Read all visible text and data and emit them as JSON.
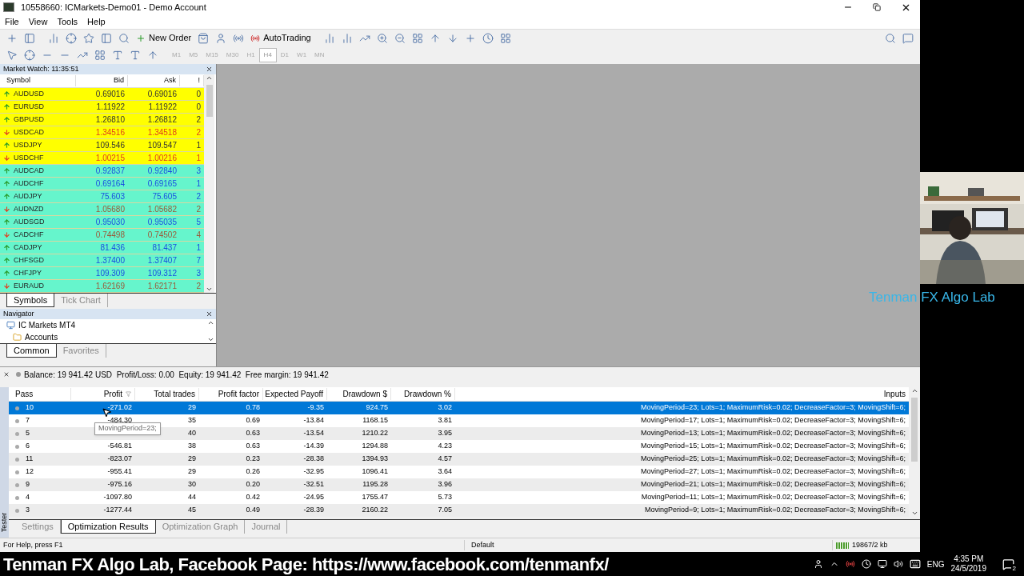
{
  "window": {
    "title": "10558660: ICMarkets-Demo01 - Demo Account"
  },
  "menu": [
    "File",
    "View",
    "Tools",
    "Help"
  ],
  "toolbar": {
    "buttons": [
      {
        "label": "New Order"
      },
      {
        "label": "AutoTrading"
      }
    ]
  },
  "timeframes": [
    {
      "label": "M1",
      "selected": false
    },
    {
      "label": "M5",
      "selected": false
    },
    {
      "label": "M15",
      "selected": false
    },
    {
      "label": "M30",
      "selected": false
    },
    {
      "label": "H1",
      "selected": false
    },
    {
      "label": "H4",
      "selected": true
    },
    {
      "label": "D1",
      "selected": false
    },
    {
      "label": "W1",
      "selected": false
    },
    {
      "label": "MN",
      "selected": false
    }
  ],
  "market_watch": {
    "title": "Market Watch: 11:35:51",
    "columns": [
      "Symbol",
      "Bid",
      "Ask",
      "!"
    ],
    "groups": [
      {
        "color": "#ffff00",
        "rows": [
          {
            "symbol": "AUDUSD",
            "bid": "0.69016",
            "ask": "0.69016",
            "spread": "0",
            "kind": "up"
          },
          {
            "symbol": "EURUSD",
            "bid": "1.11922",
            "ask": "1.11922",
            "spread": "0",
            "kind": "up"
          },
          {
            "symbol": "GBPUSD",
            "bid": "1.26810",
            "ask": "1.26812",
            "spread": "2",
            "kind": "up"
          },
          {
            "symbol": "USDCAD",
            "bid": "1.34516",
            "ask": "1.34518",
            "spread": "2",
            "kind": "down"
          },
          {
            "symbol": "USDJPY",
            "bid": "109.546",
            "ask": "109.547",
            "spread": "1",
            "kind": "up"
          },
          {
            "symbol": "USDCHF",
            "bid": "1.00215",
            "ask": "1.00216",
            "spread": "1",
            "kind": "down"
          }
        ]
      },
      {
        "color": "#66f5cc",
        "rows": [
          {
            "symbol": "AUDCAD",
            "bid": "0.92837",
            "ask": "0.92840",
            "spread": "3",
            "kind": "up"
          },
          {
            "symbol": "AUDCHF",
            "bid": "0.69164",
            "ask": "0.69165",
            "spread": "1",
            "kind": "up"
          },
          {
            "symbol": "AUDJPY",
            "bid": "75.603",
            "ask": "75.605",
            "spread": "2",
            "kind": "up"
          },
          {
            "symbol": "AUDNZD",
            "bid": "1.05680",
            "ask": "1.05682",
            "spread": "2",
            "kind": "down"
          },
          {
            "symbol": "AUDSGD",
            "bid": "0.95030",
            "ask": "0.95035",
            "spread": "5",
            "kind": "up"
          },
          {
            "symbol": "CADCHF",
            "bid": "0.74498",
            "ask": "0.74502",
            "spread": "4",
            "kind": "down"
          },
          {
            "symbol": "CADJPY",
            "bid": "81.436",
            "ask": "81.437",
            "spread": "1",
            "kind": "up"
          },
          {
            "symbol": "CHFSGD",
            "bid": "1.37400",
            "ask": "1.37407",
            "spread": "7",
            "kind": "up"
          },
          {
            "symbol": "CHFJPY",
            "bid": "109.309",
            "ask": "109.312",
            "spread": "3",
            "kind": "up"
          },
          {
            "symbol": "EURAUD",
            "bid": "1.62169",
            "ask": "1.62171",
            "spread": "2",
            "kind": "down"
          }
        ]
      }
    ],
    "tabs": [
      {
        "label": "Symbols",
        "selected": true
      },
      {
        "label": "Tick Chart",
        "selected": false
      }
    ]
  },
  "navigator": {
    "title": "Navigator",
    "items": [
      {
        "label": "IC Markets MT4",
        "kind": "root"
      },
      {
        "label": "Accounts",
        "kind": "folder"
      }
    ],
    "tabs": [
      {
        "label": "Common",
        "selected": true
      },
      {
        "label": "Favorites",
        "selected": false
      }
    ]
  },
  "tester": {
    "summary": "Balance: 19 941.42 USD  Profit/Loss: 0.00  Equity: 19 941.42  Free margin: 19 941.42",
    "side_label": "Tester",
    "columns": [
      "Pass",
      "Profit",
      "Total trades",
      "Profit factor",
      "Expected Payoff",
      "Drawdown $",
      "Drawdown %",
      "Inputs"
    ],
    "rows": [
      {
        "pass": "10",
        "profit": "-271.02",
        "trades": "29",
        "factor": "0.78",
        "payoff": "-9.35",
        "dd": "924.75",
        "ddp": "3.02",
        "inputs": "MovingPeriod=23; Lots=1; MaximumRisk=0.02; DecreaseFactor=3; MovingShift=6;",
        "selected": true
      },
      {
        "pass": "7",
        "profit": "-484.30",
        "trades": "35",
        "factor": "0.69",
        "payoff": "-13.84",
        "dd": "1168.15",
        "ddp": "3.81",
        "inputs": "MovingPeriod=17; Lots=1; MaximumRisk=0.02; DecreaseFactor=3; MovingShift=6;",
        "selected": false
      },
      {
        "pass": "5",
        "trades": "40",
        "factor": "0.63",
        "payoff": "-13.54",
        "dd": "1210.22",
        "ddp": "3.95",
        "inputs": "MovingPeriod=13; Lots=1; MaximumRisk=0.02; DecreaseFactor=3; MovingShift=6;",
        "selected": false
      },
      {
        "pass": "6",
        "profit": "-546.81",
        "trades": "38",
        "factor": "0.63",
        "payoff": "-14.39",
        "dd": "1294.88",
        "ddp": "4.23",
        "inputs": "MovingPeriod=15; Lots=1; MaximumRisk=0.02; DecreaseFactor=3; MovingShift=6;",
        "selected": false
      },
      {
        "pass": "11",
        "profit": "-823.07",
        "trades": "29",
        "factor": "0.23",
        "payoff": "-28.38",
        "dd": "1394.93",
        "ddp": "4.57",
        "inputs": "MovingPeriod=25; Lots=1; MaximumRisk=0.02; DecreaseFactor=3; MovingShift=6;",
        "selected": false
      },
      {
        "pass": "12",
        "profit": "-955.41",
        "trades": "29",
        "factor": "0.26",
        "payoff": "-32.95",
        "dd": "1096.41",
        "ddp": "3.64",
        "inputs": "MovingPeriod=27; Lots=1; MaximumRisk=0.02; DecreaseFactor=3; MovingShift=6;",
        "selected": false
      },
      {
        "pass": "9",
        "profit": "-975.16",
        "trades": "30",
        "factor": "0.20",
        "payoff": "-32.51",
        "dd": "1195.28",
        "ddp": "3.96",
        "inputs": "MovingPeriod=21; Lots=1; MaximumRisk=0.02; DecreaseFactor=3; MovingShift=6;",
        "selected": false
      },
      {
        "pass": "4",
        "profit": "-1097.80",
        "trades": "44",
        "factor": "0.42",
        "payoff": "-24.95",
        "dd": "1755.47",
        "ddp": "5.73",
        "inputs": "MovingPeriod=11; Lots=1; MaximumRisk=0.02; DecreaseFactor=3; MovingShift=6;",
        "selected": false
      },
      {
        "pass": "3",
        "profit": "-1277.44",
        "trades": "45",
        "factor": "0.49",
        "payoff": "-28.39",
        "dd": "2160.22",
        "ddp": "7.05",
        "inputs": "MovingPeriod=9; Lots=1; MaximumRisk=0.02; DecreaseFactor=3; MovingShift=6;",
        "selected": false
      }
    ],
    "tooltip": "MovingPeriod=23;",
    "tabs": [
      {
        "label": "Settings",
        "selected": false
      },
      {
        "label": "Optimization Results",
        "selected": true
      },
      {
        "label": "Optimization Graph",
        "selected": false
      },
      {
        "label": "Journal",
        "selected": false
      }
    ]
  },
  "status_bar": {
    "help": "For Help, press F1",
    "profile": "Default",
    "traffic": "19867/2 kb"
  },
  "overlay_text": "Tenman FX Algo Lab",
  "caption": "Tenman FX Algo Lab, Facebook Page: https://www.facebook.com/tenmanfx/",
  "taskbar": {
    "language": "ENG",
    "time": "4:35 PM",
    "date": "24/5/2019",
    "notifications": "2"
  }
}
